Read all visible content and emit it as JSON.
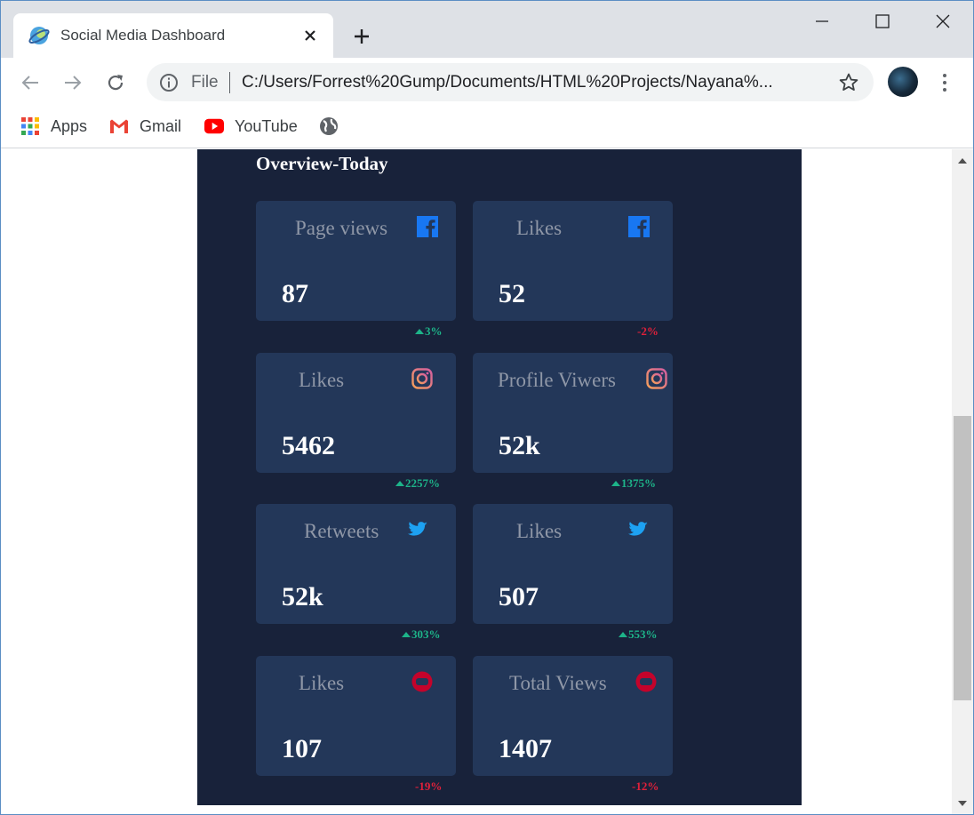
{
  "browser": {
    "tab_title": "Social Media Dashboard",
    "new_tab": "+",
    "omnibox": {
      "scheme_label": "File",
      "url": "C:/Users/Forrest%20Gump/Documents/HTML%20Projects/Nayana%..."
    },
    "bookmarks": [
      {
        "label": "Apps",
        "icon": "apps-grid-icon"
      },
      {
        "label": "Gmail",
        "icon": "gmail-icon"
      },
      {
        "label": "YouTube",
        "icon": "youtube-icon"
      },
      {
        "label": "",
        "icon": "globe-icon"
      }
    ]
  },
  "dashboard": {
    "section_title": "Overview-Today",
    "colors": {
      "background": "#18223a",
      "card": "#233759",
      "up": "#1db489",
      "down": "#e0203a",
      "facebook": "#1877f2",
      "instagram": "#e57f6f",
      "twitter": "#1da1f2",
      "youtube": "#c4032b"
    },
    "cards": [
      {
        "platform": "facebook",
        "icon": "facebook-icon",
        "label": "Page views",
        "value": "87",
        "change": "3%",
        "trend": "up"
      },
      {
        "platform": "facebook",
        "icon": "facebook-icon",
        "label": "Likes",
        "value": "52",
        "change": "-2%",
        "trend": "down"
      },
      {
        "platform": "instagram",
        "icon": "instagram-icon",
        "label": "Likes",
        "value": "5462",
        "change": "2257%",
        "trend": "up"
      },
      {
        "platform": "instagram",
        "icon": "instagram-icon",
        "label": "Profile Viwers",
        "value": "52k",
        "change": "1375%",
        "trend": "up"
      },
      {
        "platform": "twitter",
        "icon": "twitter-icon",
        "label": "Retweets",
        "value": "52k",
        "change": "303%",
        "trend": "up"
      },
      {
        "platform": "twitter",
        "icon": "twitter-icon",
        "label": "Likes",
        "value": "507",
        "change": "553%",
        "trend": "up"
      },
      {
        "platform": "youtube",
        "icon": "youtube-icon",
        "label": "Likes",
        "value": "107",
        "change": "-19%",
        "trend": "down"
      },
      {
        "platform": "youtube",
        "icon": "youtube-icon",
        "label": "Total Views",
        "value": "1407",
        "change": "-12%",
        "trend": "down"
      }
    ]
  }
}
